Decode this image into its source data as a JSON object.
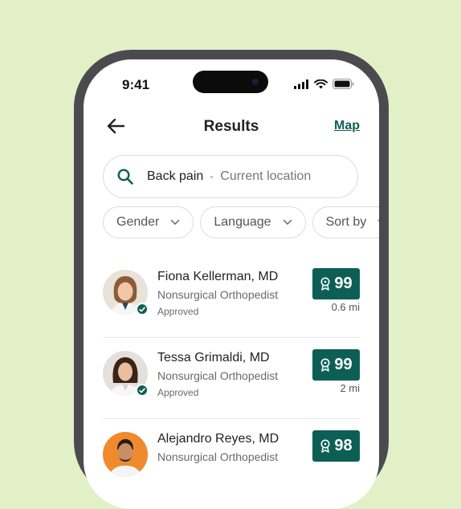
{
  "status_bar": {
    "time": "9:41"
  },
  "header": {
    "title": "Results",
    "map_link": "Map"
  },
  "search": {
    "query": "Back pain",
    "location": "Current location"
  },
  "filters": [
    {
      "label": "Gender"
    },
    {
      "label": "Language"
    },
    {
      "label": "Sort by"
    }
  ],
  "results": [
    {
      "name": "Fiona Kellerman, MD",
      "specialty": "Nonsurgical Orthopedist",
      "status": "Approved",
      "score": "99",
      "distance": "0.6 mi"
    },
    {
      "name": "Tessa Grimaldi, MD",
      "specialty": "Nonsurgical Orthopedist",
      "status": "Approved",
      "score": "99",
      "distance": "2 mi"
    },
    {
      "name": "Alejandro Reyes, MD",
      "specialty": "Nonsurgical Orthopedist",
      "status": "",
      "score": "98",
      "distance": ""
    }
  ],
  "icons": {
    "back": "arrow-left-icon",
    "search": "search-icon",
    "chevron": "chevron-down-icon",
    "award": "award-ribbon-icon",
    "verified": "check-icon"
  },
  "colors": {
    "brand": "#0d5f55",
    "background": "#e2f0c8",
    "frame": "#4b4b4f"
  }
}
